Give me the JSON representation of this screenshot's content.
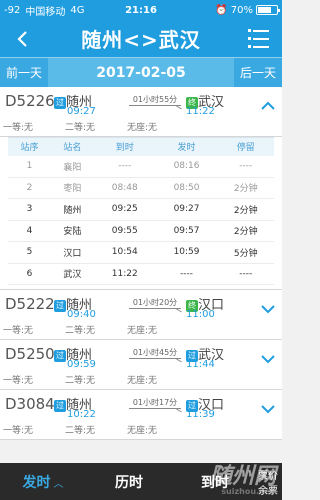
{
  "status": {
    "signal": "-92",
    "carrier": "中国移动",
    "network": "4G",
    "time": "21:16",
    "battery_pct": "70%",
    "battery_level": 0.7
  },
  "nav": {
    "title": "随州<>武汉"
  },
  "datebar": {
    "prev": "前一天",
    "date": "2017-02-05",
    "next": "后一天"
  },
  "trains": [
    {
      "num": "D5226",
      "dep_badge": "过",
      "dep": "随州",
      "dep_time": "09:27",
      "duration": "01小时55分",
      "arr_badge": "终",
      "arr": "武汉",
      "arr_time": "11:22",
      "seat1": "一等:无",
      "seat2": "二等:无",
      "seat3": "无座:无",
      "expanded": true
    },
    {
      "num": "D5222",
      "dep_badge": "过",
      "dep": "随州",
      "dep_time": "09:40",
      "duration": "01小时20分",
      "arr_badge": "终",
      "arr": "汉口",
      "arr_time": "11:00",
      "seat1": "一等:无",
      "seat2": "二等:无",
      "seat3": "无座:无"
    },
    {
      "num": "D5250",
      "dep_badge": "过",
      "dep": "随州",
      "dep_time": "09:59",
      "duration": "01小时45分",
      "arr_badge": "过",
      "arr": "武汉",
      "arr_time": "11:44",
      "seat1": "一等:无",
      "seat2": "二等:无",
      "seat3": "无座:无"
    },
    {
      "num": "D3084",
      "dep_badge": "过",
      "dep": "随州",
      "dep_time": "10:22",
      "duration": "01小时17分",
      "arr_badge": "过",
      "arr": "汉口",
      "arr_time": "11:39",
      "seat1": "一等:无",
      "seat2": "二等:无",
      "seat3": "无座:无"
    }
  ],
  "stops": {
    "headers": [
      "站序",
      "站名",
      "到时",
      "发时",
      "停留"
    ],
    "rows": [
      {
        "seq": "1",
        "name": "襄阳",
        "arrive": "----",
        "depart": "08:16",
        "stay": "----",
        "past": true
      },
      {
        "seq": "2",
        "name": "枣阳",
        "arrive": "08:48",
        "depart": "08:50",
        "stay": "2分钟",
        "past": true
      },
      {
        "seq": "3",
        "name": "随州",
        "arrive": "09:25",
        "depart": "09:27",
        "stay": "2分钟",
        "past": false
      },
      {
        "seq": "4",
        "name": "安陆",
        "arrive": "09:55",
        "depart": "09:57",
        "stay": "2分钟",
        "past": false
      },
      {
        "seq": "5",
        "name": "汉口",
        "arrive": "10:54",
        "depart": "10:59",
        "stay": "5分钟",
        "past": false
      },
      {
        "seq": "6",
        "name": "武汉",
        "arrive": "11:22",
        "depart": "----",
        "stay": "----",
        "past": false
      }
    ]
  },
  "bottom": {
    "depart": "发时",
    "duration": "历时",
    "arrive": "到时",
    "price": "票价",
    "ticket": "余票",
    "sort_arrow": "︿"
  },
  "watermark": {
    "text": "随州网",
    "url": "suizhou.net"
  }
}
